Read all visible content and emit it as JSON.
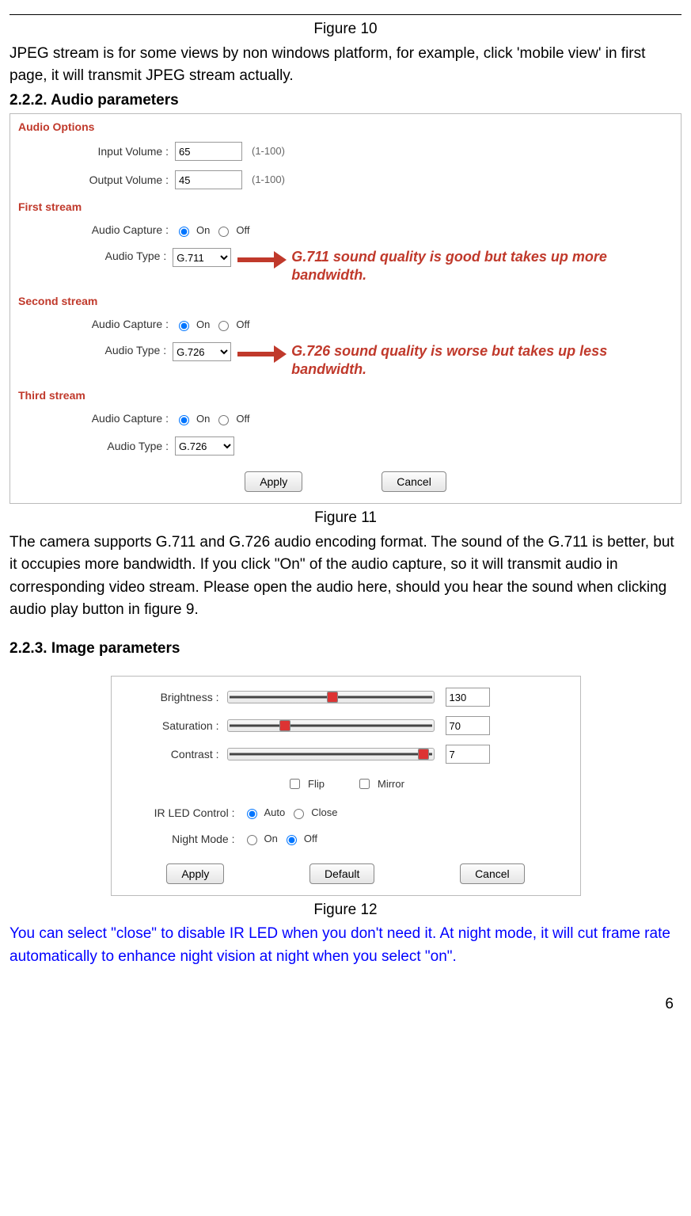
{
  "figure10_caption": "Figure 10",
  "jpeg_text": "JPEG stream is for some views by non windows platform, for example, click 'mobile view' in first page, it will transmit JPEG stream actually.",
  "heading_222": "2.2.2.  Audio parameters",
  "audio": {
    "section_options": "Audio Options",
    "input_volume_label": "Input Volume :",
    "input_volume_value": "65",
    "output_volume_label": "Output Volume :",
    "output_volume_value": "45",
    "range_hint": "(1-100)",
    "first_stream": "First stream",
    "second_stream": "Second stream",
    "third_stream": "Third stream",
    "audio_capture_label": "Audio Capture :",
    "audio_type_label": "Audio Type :",
    "on": "On",
    "off": "Off",
    "type_g711": "G.711",
    "type_g726": "G.726",
    "annot1": "G.711 sound quality is good but takes up more bandwidth.",
    "annot2": "G.726 sound quality is worse but takes up less bandwidth.",
    "apply": "Apply",
    "cancel": "Cancel"
  },
  "figure11_caption": "Figure 11",
  "audio_para": "The camera supports G.711 and G.726 audio encoding format. The sound of the G.711 is better, but it occupies more bandwidth. If you click \"On\" of the audio capture, so it will transmit audio in corresponding video stream. Please open the audio here, should you hear the sound when clicking audio play button in figure 9.",
  "heading_223": "2.2.3.  Image parameters",
  "image": {
    "brightness_label": "Brightness :",
    "brightness_value": "130",
    "saturation_label": "Saturation :",
    "saturation_value": "70",
    "contrast_label": "Contrast :",
    "contrast_value": "7",
    "flip": "Flip",
    "mirror": "Mirror",
    "ir_label": "IR LED Control :",
    "auto": "Auto",
    "close": "Close",
    "night_label": "Night Mode :",
    "on": "On",
    "off": "Off",
    "apply": "Apply",
    "default": "Default",
    "cancel": "Cancel"
  },
  "figure12_caption": "Figure 12",
  "blue_note": "You can select \"close\" to disable IR LED when you don't need it. At night mode, it will cut frame rate automatically to enhance night vision at night when you select \"on\".",
  "page_number": "6"
}
